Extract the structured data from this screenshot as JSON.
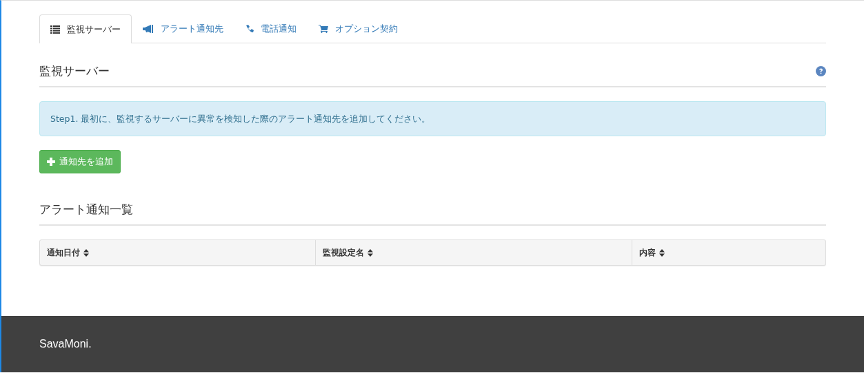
{
  "tabs": [
    {
      "label": "監視サーバー",
      "selected": true
    },
    {
      "label": "アラート通知先",
      "selected": false
    },
    {
      "label": "電話通知",
      "selected": false
    },
    {
      "label": "オプション契約",
      "selected": false
    }
  ],
  "section_title": "監視サーバー",
  "alert": "Step1. 最初に、監視するサーバーに異常を検知した際のアラート通知先を追加してください。",
  "add_button": "通知先を追加",
  "list_title": "アラート通知一覧",
  "table": {
    "columns": [
      "通知日付",
      "監視設定名",
      "内容"
    ]
  },
  "footer": {
    "brand": "SavaMoni."
  }
}
